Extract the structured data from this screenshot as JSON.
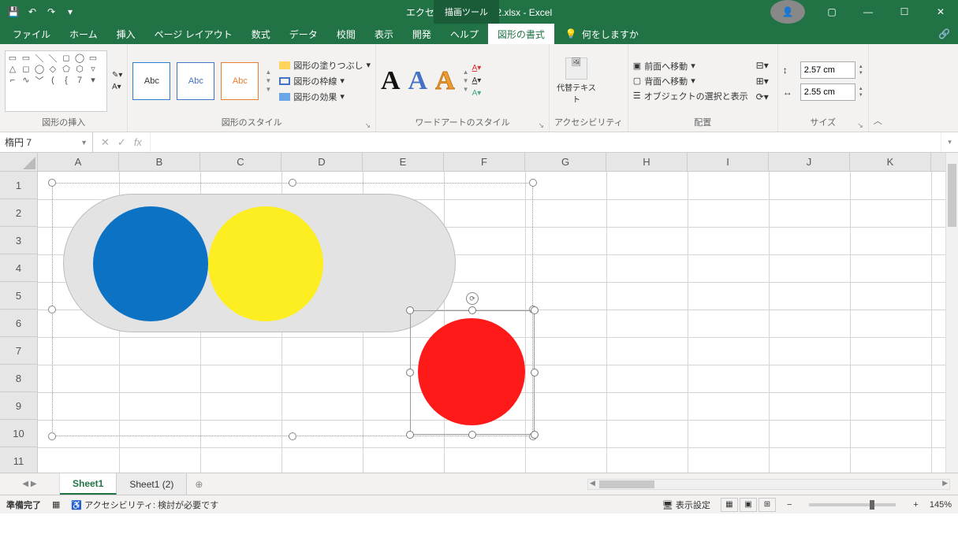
{
  "titlebar": {
    "document_title": "エクセル グループ化-2.xlsx  -  Excel",
    "tool_context_tab": "描画ツール"
  },
  "tabs": {
    "file": "ファイル",
    "home": "ホーム",
    "insert": "挿入",
    "pagelayout": "ページ レイアウト",
    "formulas": "数式",
    "data": "データ",
    "review": "校閲",
    "view": "表示",
    "developer": "開発",
    "help": "ヘルプ",
    "shape_format": "図形の書式",
    "tellme": "何をしますか"
  },
  "ribbon": {
    "groups": {
      "insert_shapes": "図形の挿入",
      "shape_styles": "図形のスタイル",
      "wordart_styles": "ワードアートのスタイル",
      "accessibility": "アクセシビリティ",
      "arrange": "配置",
      "size": "サイズ"
    },
    "style_sample": "Abc",
    "shape_fill": "図形の塗りつぶし",
    "shape_outline": "図形の枠線",
    "shape_effects": "図形の効果",
    "alt_text": "代替テキスト",
    "bring_forward": "前面へ移動",
    "send_backward": "背面へ移動",
    "selection_pane": "オブジェクトの選択と表示",
    "size_height": "2.57 cm",
    "size_width": "2.55 cm"
  },
  "namebox": {
    "value": "楕円 7"
  },
  "columns": [
    "A",
    "B",
    "C",
    "D",
    "E",
    "F",
    "G",
    "H",
    "I",
    "J",
    "K"
  ],
  "rows": [
    "1",
    "2",
    "3",
    "4",
    "5",
    "6",
    "7",
    "8",
    "9",
    "10",
    "11"
  ],
  "sheets": {
    "active": "Sheet1",
    "other": "Sheet1 (2)"
  },
  "statusbar": {
    "ready": "準備完了",
    "accessibility": "アクセシビリティ: 検討が必要です",
    "display_settings": "表示設定",
    "zoom": "145%"
  }
}
